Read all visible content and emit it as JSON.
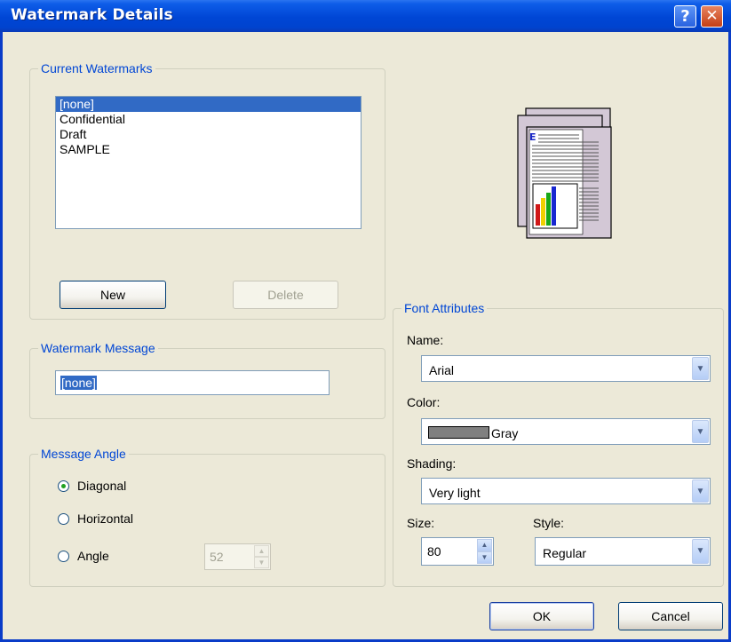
{
  "window": {
    "title": "Watermark Details",
    "help_label": "?",
    "close_label": "✕"
  },
  "current_watermarks": {
    "legend": "Current Watermarks",
    "items": [
      "[none]",
      "Confidential",
      "Draft",
      "SAMPLE"
    ],
    "selected": "[none]",
    "new_label": "New",
    "delete_label": "Delete"
  },
  "watermark_message": {
    "legend": "Watermark Message",
    "value": "[none]"
  },
  "message_angle": {
    "legend": "Message Angle",
    "options": [
      "Diagonal",
      "Horizontal",
      "Angle"
    ],
    "selected": "Diagonal",
    "angle_value": "52"
  },
  "font_attributes": {
    "legend": "Font Attributes",
    "name_label": "Name:",
    "name_value": "Arial",
    "color_label": "Color:",
    "color_value": "Gray",
    "color_swatch": "#808080",
    "shading_label": "Shading:",
    "shading_value": "Very light",
    "size_label": "Size:",
    "size_value": "80",
    "style_label": "Style:",
    "style_value": "Regular"
  },
  "footer": {
    "ok_label": "OK",
    "cancel_label": "Cancel"
  },
  "preview": {
    "icon": "document-pages-with-chart-icon"
  }
}
